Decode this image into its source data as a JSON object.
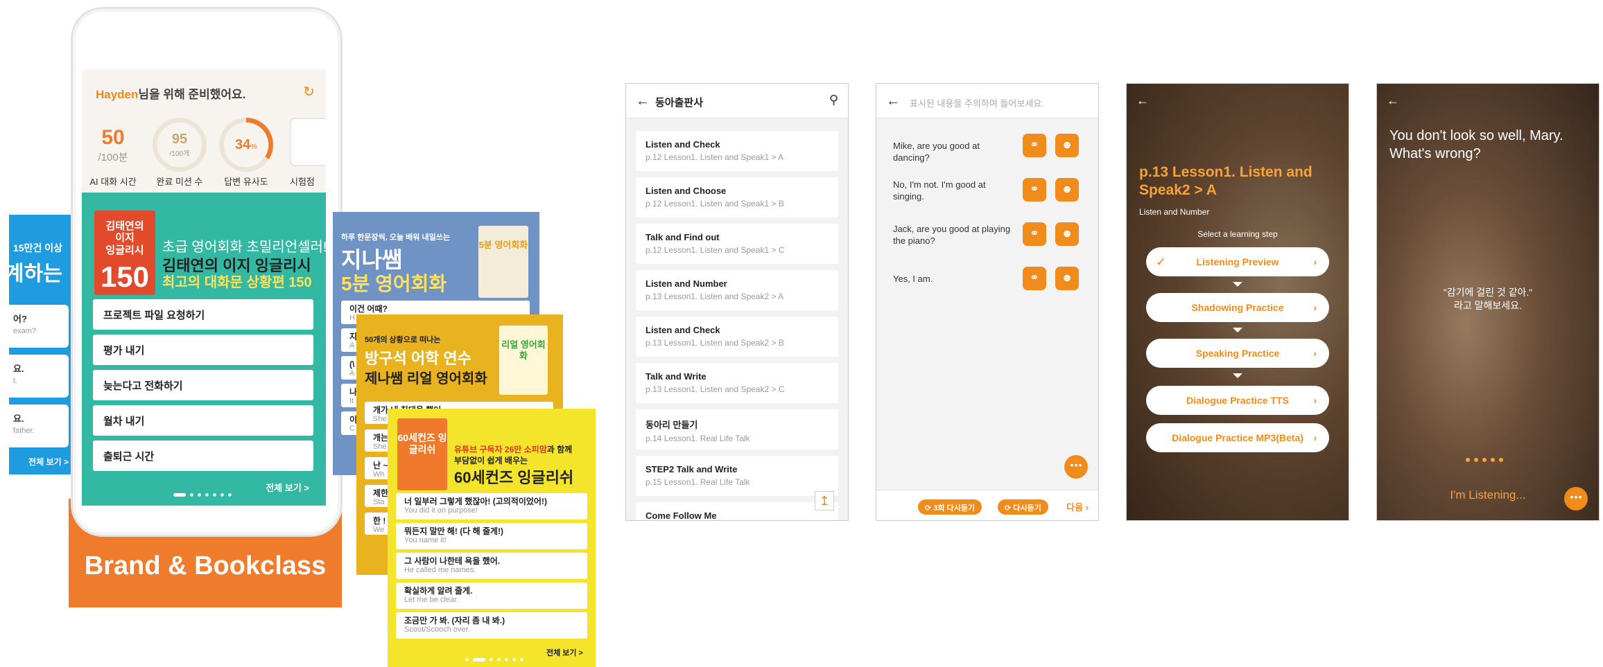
{
  "brand": {
    "label": "Brand & Bookclass"
  },
  "edge_card": {
    "top": "15만건 이상",
    "big": "계하는",
    "items": [
      {
        "title": "어?",
        "sub": "exam?"
      },
      {
        "title": "요.",
        "sub": "t."
      },
      {
        "title": "요.",
        "sub": "father."
      }
    ],
    "more": "전체 보기 >"
  },
  "phone": {
    "greeting_name": "Hayden",
    "greeting_rest": "님을 위해 준비했어요.",
    "refresh_icon": "↻",
    "stats": [
      {
        "num": "50",
        "sub": "/100분",
        "label": "AI 대화 시간"
      },
      {
        "num": "95",
        "sub": "/100개",
        "label": "완료 미션 수"
      },
      {
        "num": "34",
        "sub": "%",
        "label": "답변 유사도"
      },
      {
        "num": "",
        "sub": "",
        "label": "시험점"
      }
    ],
    "book": {
      "line1": "김태연의",
      "line2": "이지",
      "line3": "잉글리시",
      "num": "150"
    },
    "promo": {
      "line1": "초급 영어회화 초밀리언셀러!",
      "line2": "김태연의 이지 잉글리시",
      "line3": "최고의 대화문 상황편 150"
    },
    "items": [
      "프로젝트 파일 요청하기",
      "평가 내기",
      "늦는다고 전화하기",
      "월차 내기",
      "출퇴근 시간"
    ],
    "more": "전체 보기 >"
  },
  "card_blue": {
    "head1": "하루 한문장씩, 오늘 배워 내일쓰는",
    "head2": "지나쌤",
    "head3": "5분 영어회화",
    "book": "5분 영어회화",
    "items": [
      {
        "title": "이건 어때?",
        "sub": "H"
      },
      {
        "title": "지",
        "sub": "A"
      },
      {
        "title": "(\\",
        "sub": "A"
      },
      {
        "title": "나",
        "sub": "It"
      },
      {
        "title": "이",
        "sub": "C"
      }
    ]
  },
  "card_orange": {
    "head1": "50개의 상황으로 떠나는",
    "head2": "방구석 어학 연수",
    "head3": "제나쌤 리얼 영어회화",
    "book": "리얼 영어회화",
    "items": [
      {
        "title": "개가 내 침대올 했어",
        "sub": "She"
      },
      {
        "title": "개는",
        "sub": "She"
      },
      {
        "title": "난 ~",
        "sub": "Wh"
      },
      {
        "title": "제한",
        "sub": "Sta"
      },
      {
        "title": "한 !",
        "sub": "We"
      }
    ]
  },
  "card_yellow": {
    "head1a": "유튜브 구독자 26만 소피맘",
    "head1b": "과 함께",
    "head2": "부담없이 쉽게 배우는",
    "head3": "60세컨즈 잉글리쉬",
    "book": "60세컨즈 잉글리쉬",
    "items": [
      {
        "title": "너 일부러 그렇게 했잖아! (고의적이었어!)",
        "sub": "You did it on purpose!"
      },
      {
        "title": "뭐든지 말만 해! (다 해 줄게!)",
        "sub": "You name it!"
      },
      {
        "title": "그 사람이 나한테 욕을 했어.",
        "sub": "He called me names."
      },
      {
        "title": "확실하게 알려 줄게.",
        "sub": "Let me be clear."
      },
      {
        "title": "조금만 가 봐. (자리 좀 내 봐.)",
        "sub": "Scoot/Scooch over."
      }
    ],
    "more": "전체 보기 >"
  },
  "screen1": {
    "title": "동아출판사",
    "lessons": [
      {
        "title": "Listen and Check",
        "sub": "p.12 Lesson1. Listen and Speak1 > A"
      },
      {
        "title": "Listen and Choose",
        "sub": "p.12 Lesson1. Listen and Speak1 > B"
      },
      {
        "title": "Talk and Find out",
        "sub": "p.12 Lesson1. Listen and Speak1 > C"
      },
      {
        "title": "Listen and Number",
        "sub": "p.13 Lesson1. Listen and Speak2 > A"
      },
      {
        "title": "Listen and Check",
        "sub": "p.13 Lesson1. Listen and Speak2 > B"
      },
      {
        "title": "Talk and Write",
        "sub": "p.13 Lesson1. Listen and Speak2 > C"
      },
      {
        "title": "동아리 만들기",
        "sub": "p.14 Lesson1. Real Life Talk"
      },
      {
        "title": "STEP2 Talk and Write",
        "sub": "p.15 Lesson1. Real Life Talk"
      },
      {
        "title": "Come Follow Me",
        "sub": ""
      }
    ]
  },
  "screen2": {
    "title": "표시된 내용을 주의하며 들어보세요.",
    "lines": [
      "Mike, are you good at dancing?",
      "No, I'm not. I'm good at singing.",
      "Jack, are you good at playing the piano?",
      "Yes, I am."
    ],
    "replay3": "3회 다시듣기",
    "replay": "다시듣기",
    "next": "다음"
  },
  "screen3": {
    "title": "p.13 Lesson1. Listen and Speak2 > A",
    "subtitle": "Listen and Number",
    "step_prompt": "Select a learning step",
    "steps": [
      "Listening Preview",
      "Shadowing Practice",
      "Speaking Practice",
      "Dialogue Practice TTS",
      "Dialogue Practice MP3(Beta)"
    ]
  },
  "screen4": {
    "question": "You don't look so well, Mary. What's wrong?",
    "hint1": "\"감기에 걸린 것 같아.\"",
    "hint2": "라고 말해보세요.",
    "status": "I'm Listening..."
  },
  "colors": {
    "accent": "#f08c1c",
    "teal": "#33b8a4",
    "brand": "#ef7b2d"
  }
}
